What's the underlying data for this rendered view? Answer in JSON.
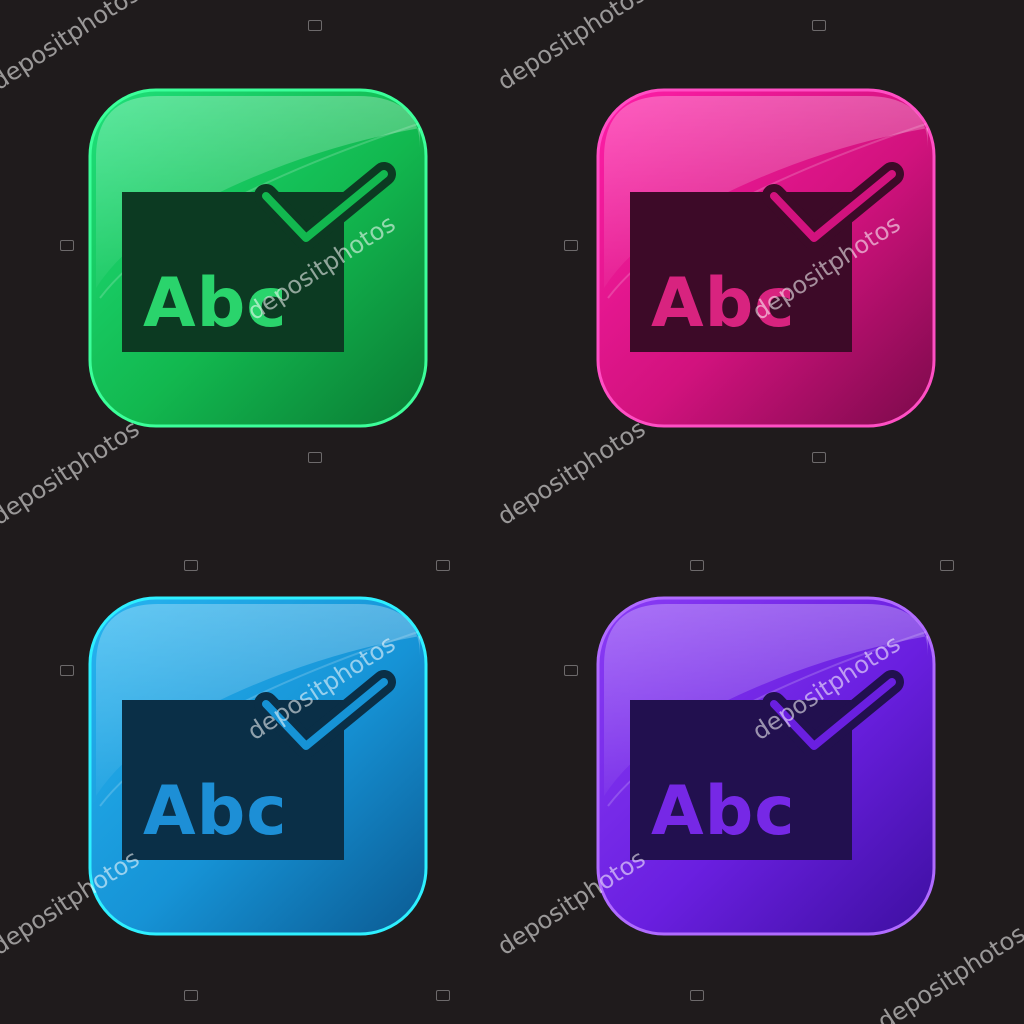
{
  "icon_label": "Abc",
  "watermark_text": "depositphotos",
  "tiles": [
    {
      "id": "green",
      "icon": "checked-abc-icon",
      "top": "#1fe07a",
      "mid": "#12b84f",
      "bottom": "#0a7a33",
      "rim": "#3cff9a",
      "board": "#0c3a22",
      "text": "#2ad46c"
    },
    {
      "id": "pink",
      "icon": "checked-abc-icon",
      "top": "#ff1ea8",
      "mid": "#d2127e",
      "bottom": "#7a0a4a",
      "rim": "#ff4fc4",
      "board": "#3d0a28",
      "text": "#d8237f"
    },
    {
      "id": "blue",
      "icon": "checked-abc-icon",
      "top": "#27b4f0",
      "mid": "#1693d6",
      "bottom": "#0b5a92",
      "rim": "#2ef0ff",
      "board": "#0a2f47",
      "text": "#1d8fd6"
    },
    {
      "id": "purple",
      "icon": "checked-abc-icon",
      "top": "#8a3cf5",
      "mid": "#6a1fe0",
      "bottom": "#3d0fa0",
      "rim": "#b06bff",
      "board": "#22104f",
      "text": "#7628e6"
    }
  ]
}
